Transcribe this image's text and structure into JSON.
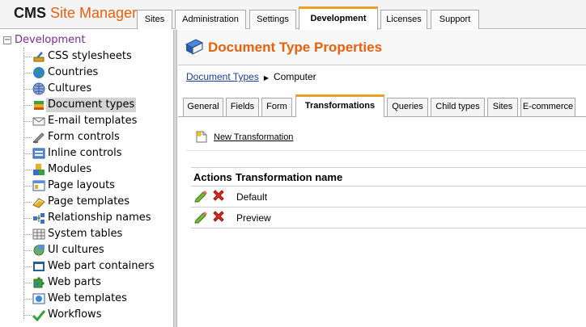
{
  "header": {
    "logo_cms": "CMS",
    "logo_site_manager": "Site Manager",
    "tabs": [
      {
        "label": "Sites"
      },
      {
        "label": "Administration"
      },
      {
        "label": "Settings"
      },
      {
        "label": "Development",
        "active": true
      },
      {
        "label": "Licenses"
      },
      {
        "label": "Support"
      }
    ]
  },
  "tree": {
    "root_label": "Development",
    "expander": "−",
    "items": [
      {
        "label": "CSS stylesheets",
        "icon": "css-stylesheets-icon"
      },
      {
        "label": "Countries",
        "icon": "globe-icon"
      },
      {
        "label": "Cultures",
        "icon": "cultures-globe-icon"
      },
      {
        "label": "Document types",
        "icon": "document-types-icon",
        "selected": true
      },
      {
        "label": "E-mail templates",
        "icon": "email-icon"
      },
      {
        "label": "Form controls",
        "icon": "form-controls-icon"
      },
      {
        "label": "Inline controls",
        "icon": "inline-controls-icon"
      },
      {
        "label": "Modules",
        "icon": "modules-icon"
      },
      {
        "label": "Page layouts",
        "icon": "page-layouts-icon"
      },
      {
        "label": "Page templates",
        "icon": "page-templates-icon"
      },
      {
        "label": "Relationship names",
        "icon": "relationship-icon"
      },
      {
        "label": "System tables",
        "icon": "system-tables-icon"
      },
      {
        "label": "UI cultures",
        "icon": "ui-cultures-icon"
      },
      {
        "label": "Web part containers",
        "icon": "web-part-containers-icon"
      },
      {
        "label": "Web parts",
        "icon": "web-parts-icon"
      },
      {
        "label": "Web templates",
        "icon": "web-templates-icon"
      },
      {
        "label": "Workflows",
        "icon": "workflows-icon"
      }
    ]
  },
  "content": {
    "title": "Document Type Properties",
    "title_icon": "book-icon",
    "breadcrumb": {
      "link": "Document Types",
      "separator": "▶",
      "current": "Computer"
    },
    "subtabs": [
      {
        "label": "General"
      },
      {
        "label": "Fields"
      },
      {
        "label": "Form"
      },
      {
        "label": "Transformations",
        "active": true
      },
      {
        "label": "Queries"
      },
      {
        "label": "Child types"
      },
      {
        "label": "Sites"
      },
      {
        "label": "E-commerce"
      }
    ],
    "new_transformation": "New Transformation",
    "grid": {
      "columns": [
        "Actions",
        "Transformation name"
      ],
      "rows": [
        {
          "name": "Default"
        },
        {
          "name": "Preview"
        }
      ]
    }
  },
  "colors": {
    "accent_orange": "#e8600c",
    "tab_highlight": "#f0a020",
    "link_blue": "#1a3d9e",
    "root_purple": "#7a2a8e"
  }
}
